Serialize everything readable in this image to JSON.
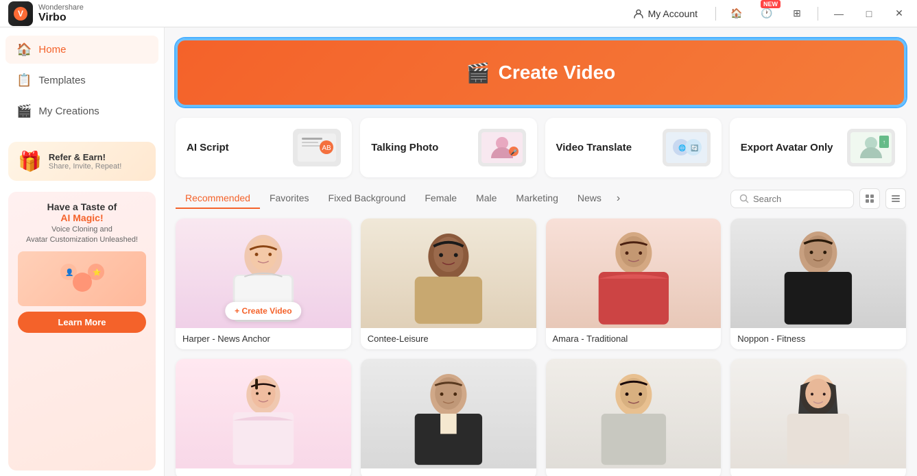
{
  "app": {
    "logo_brand": "Wondershare",
    "logo_name": "Virbo",
    "logo_icon": "V"
  },
  "titlebar": {
    "my_account": "My Account",
    "minimize": "—",
    "maximize": "□",
    "close": "✕",
    "new_badge": "NEW"
  },
  "sidebar": {
    "items": [
      {
        "id": "home",
        "label": "Home",
        "icon": "🏠",
        "active": true
      },
      {
        "id": "templates",
        "label": "Templates",
        "icon": "📄",
        "active": false
      },
      {
        "id": "my-creations",
        "label": "My Creations",
        "icon": "🎬",
        "active": false
      }
    ],
    "refer": {
      "title": "Refer & Earn!",
      "subtitle": "Share, Invite, Repeat!"
    },
    "ai_promo": {
      "title_start": "Have a Taste of",
      "title_highlight": "AI Magic!",
      "subtitle": "Voice Cloning and\nAvatar Customization Unleashed!",
      "learn_more": "Learn More"
    }
  },
  "main": {
    "create_video": "Create Video",
    "feature_cards": [
      {
        "id": "ai-script",
        "label": "AI Script"
      },
      {
        "id": "talking-photo",
        "label": "Talking Photo"
      },
      {
        "id": "video-translate",
        "label": "Video Translate"
      },
      {
        "id": "export-avatar",
        "label": "Export Avatar Only"
      }
    ],
    "category_tabs": [
      {
        "id": "recommended",
        "label": "Recommended",
        "active": true
      },
      {
        "id": "favorites",
        "label": "Favorites",
        "active": false
      },
      {
        "id": "fixed-background",
        "label": "Fixed Background",
        "active": false
      },
      {
        "id": "female",
        "label": "Female",
        "active": false
      },
      {
        "id": "male",
        "label": "Male",
        "active": false
      },
      {
        "id": "marketing",
        "label": "Marketing",
        "active": false
      },
      {
        "id": "news",
        "label": "News",
        "active": false
      }
    ],
    "search_placeholder": "Search",
    "avatars_row1": [
      {
        "id": "harper",
        "name": "Harper - News Anchor",
        "bg": "pink-bg",
        "has_overlay": true
      },
      {
        "id": "contee",
        "name": "Contee-Leisure",
        "bg": "tan-bg",
        "has_overlay": false
      },
      {
        "id": "amara",
        "name": "Amara - Traditional",
        "bg": "red-bg",
        "has_overlay": false
      },
      {
        "id": "noppon",
        "name": "Noppon - Fitness",
        "bg": "dark-bg",
        "has_overlay": false
      }
    ],
    "avatars_row2": [
      {
        "id": "avatar5",
        "name": "",
        "bg": "pink2-bg",
        "has_overlay": false
      },
      {
        "id": "avatar6",
        "name": "",
        "bg": "gray-bg",
        "has_overlay": false
      },
      {
        "id": "avatar7",
        "name": "",
        "bg": "cream-bg",
        "has_overlay": false
      },
      {
        "id": "avatar8",
        "name": "",
        "bg": "light-bg",
        "has_overlay": false
      }
    ],
    "create_video_overlay_label": "+ Create Video"
  }
}
